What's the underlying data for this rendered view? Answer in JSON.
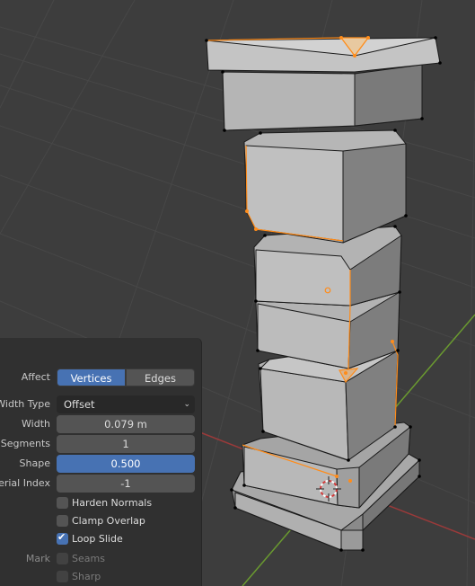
{
  "operator_panel": {
    "affect": {
      "label": "Affect",
      "options": [
        "Vertices",
        "Edges"
      ],
      "selected": "Vertices"
    },
    "width_type": {
      "label": "Width Type",
      "value": "Offset"
    },
    "width": {
      "label": "Width",
      "value": "0.079 m"
    },
    "segments": {
      "label": "Segments",
      "value": "1"
    },
    "shape": {
      "label": "Shape",
      "value": "0.500"
    },
    "material_index": {
      "label": "Material Index",
      "value": "-1"
    },
    "harden_normals": {
      "label": "Harden Normals",
      "checked": false
    },
    "clamp_overlap": {
      "label": "Clamp Overlap",
      "checked": false
    },
    "loop_slide": {
      "label": "Loop Slide",
      "checked": true
    },
    "mark": {
      "label": "Mark",
      "seams": "Seams",
      "sharp": "Sharp"
    }
  },
  "colors": {
    "viewport_bg": "#3d3d3d",
    "grid_line": "#4a4a4a",
    "x_axis": "#a04040",
    "y_axis": "#6a9a30",
    "selection": "#ff8c1a",
    "mesh_face": "#b4b4b4",
    "accent_blue": "#4772b3"
  },
  "icons": {
    "cursor": "3d-cursor-icon"
  }
}
